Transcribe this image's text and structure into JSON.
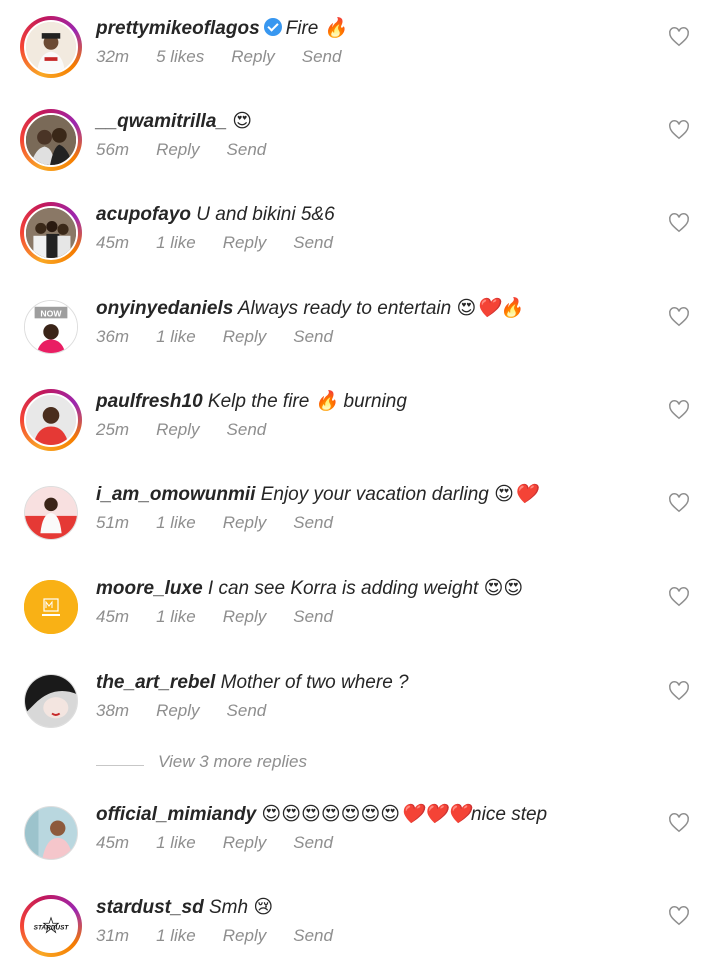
{
  "comments": [
    {
      "username": "prettymikeoflagos",
      "verified": true,
      "text": "Fire 🔥",
      "time": "32m",
      "likes": "5 likes",
      "reply": "Reply",
      "send": "Send"
    },
    {
      "username": "__qwamitrilla_",
      "verified": false,
      "text": " 😍",
      "time": "56m",
      "likes": "",
      "reply": "Reply",
      "send": "Send"
    },
    {
      "username": "acupofayo",
      "verified": false,
      "text": " U and bikini 5&6",
      "time": "45m",
      "likes": "1 like",
      "reply": "Reply",
      "send": "Send"
    },
    {
      "username": "onyinyedaniels",
      "verified": false,
      "text": " Always ready to entertain 😍❤️🔥",
      "time": "36m",
      "likes": "1 like",
      "reply": "Reply",
      "send": "Send"
    },
    {
      "username": "paulfresh10",
      "verified": false,
      "text": " Kelp the fire 🔥 burning",
      "time": "25m",
      "likes": "",
      "reply": "Reply",
      "send": "Send"
    },
    {
      "username": "i_am_omowunmii",
      "verified": false,
      "text": " Enjoy your vacation darling 😍❤️",
      "time": "51m",
      "likes": "1 like",
      "reply": "Reply",
      "send": "Send"
    },
    {
      "username": "moore_luxe",
      "verified": false,
      "text": " I can see Korra is adding weight 😍😍",
      "time": "45m",
      "likes": "1 like",
      "reply": "Reply",
      "send": "Send"
    },
    {
      "username": "the_art_rebel",
      "verified": false,
      "text": " Mother of two where ?",
      "time": "38m",
      "likes": "",
      "reply": "Reply",
      "send": "Send"
    },
    {
      "username": "official_mimiandy",
      "verified": false,
      "text": " 😍😍😍😍😍😍😍❤️❤️❤️nice step",
      "time": "45m",
      "likes": "1 like",
      "reply": "Reply",
      "send": "Send"
    },
    {
      "username": "stardust_sd",
      "verified": false,
      "text": " Smh 😢",
      "time": "31m",
      "likes": "1 like",
      "reply": "Reply",
      "send": "Send"
    }
  ],
  "view_more": "View 3 more replies",
  "avatar_labels": {
    "now": "NOW",
    "stardust": "STARDUST"
  },
  "colors": {
    "username": "#262626",
    "meta": "#8e8e8e",
    "verified": "#3897f0",
    "moore_bg": "#f9b115"
  }
}
